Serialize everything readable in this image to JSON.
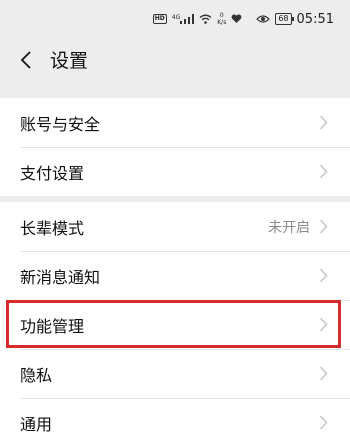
{
  "status_bar": {
    "hd_label": "HD",
    "net_label": "4G",
    "net_speed_value": "0",
    "net_speed_unit": "K/s",
    "battery": "68",
    "time": "05:51"
  },
  "header": {
    "title": "设置"
  },
  "groups": [
    {
      "items": [
        {
          "label": "账号与安全",
          "value": ""
        },
        {
          "label": "支付设置",
          "value": ""
        }
      ]
    },
    {
      "items": [
        {
          "label": "长辈模式",
          "value": "未开启"
        },
        {
          "label": "新消息通知",
          "value": ""
        },
        {
          "label": "功能管理",
          "value": ""
        },
        {
          "label": "隐私",
          "value": ""
        },
        {
          "label": "通用",
          "value": ""
        }
      ]
    }
  ],
  "highlighted_item": "功能管理",
  "colors": {
    "highlight": "#d62b2b",
    "background": "#ededed",
    "chevron": "#c4c4c4"
  }
}
